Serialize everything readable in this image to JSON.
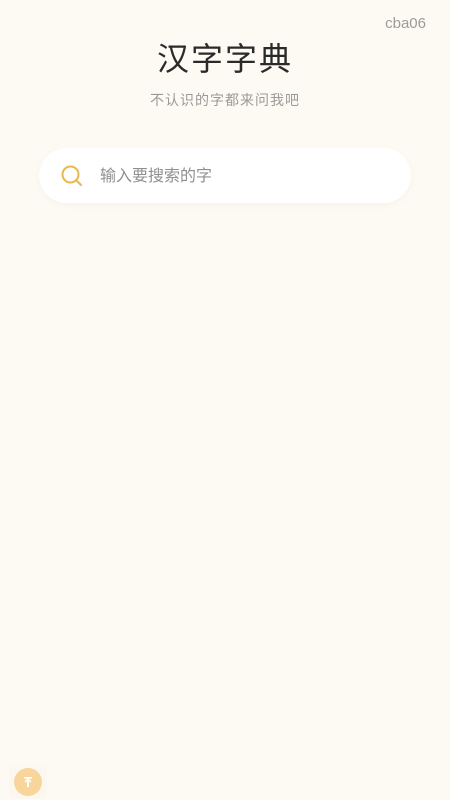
{
  "corner_tag": "cba06",
  "header": {
    "title": "汉字字典",
    "subtitle": "不认识的字都来问我吧"
  },
  "search": {
    "placeholder": "输入要搜索的字",
    "value": ""
  },
  "float_button": {
    "icon": "pin-icon"
  },
  "colors": {
    "background": "#fdf9f3",
    "accent": "#e6b84d",
    "float_button_fill": "#f7d59b"
  }
}
